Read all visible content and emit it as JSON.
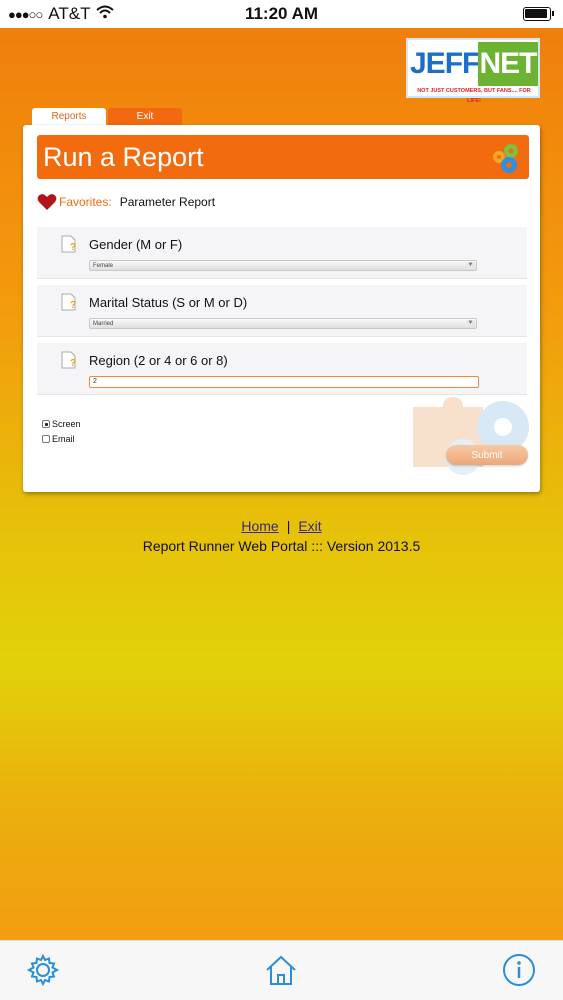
{
  "status_bar": {
    "signal": "●●●○○",
    "carrier": "AT&T",
    "time": "11:20 AM"
  },
  "logo": {
    "jeff": "JEFF",
    "net": "NET",
    "tagline": "NOT JUST CUSTOMERS, BUT FANS.... FOR LIFE!"
  },
  "tabs": [
    {
      "label": "Reports",
      "active": true
    },
    {
      "label": "Exit",
      "active": false
    }
  ],
  "card": {
    "title": "Run a Report",
    "favorites_label": "Favorites:",
    "favorites_value": "Parameter Report",
    "parameters": [
      {
        "label": "Gender (M or F)",
        "type": "select",
        "value": "Female"
      },
      {
        "label": "Marital Status (S or M or D)",
        "type": "select",
        "value": "Married"
      },
      {
        "label": "Region (2 or 4 or 6 or 8)",
        "type": "input",
        "value": "2"
      }
    ],
    "output_options": [
      {
        "label": "Screen",
        "checked": true
      },
      {
        "label": "Email",
        "checked": false
      }
    ],
    "submit_label": "Submit"
  },
  "footer": {
    "home_link": "Home",
    "separator": "|",
    "exit_link": "Exit",
    "version_text": "Report Runner Web Portal ::: Version 2013.5"
  },
  "bottom_bar": {
    "icons": [
      "gear-icon",
      "home-icon",
      "info-icon"
    ],
    "icon_color": "#2a8fd6"
  },
  "colors": {
    "accent_orange": "#f26b0e",
    "favorites_orange": "#ef6d12",
    "link_color": "#3a2a80"
  }
}
